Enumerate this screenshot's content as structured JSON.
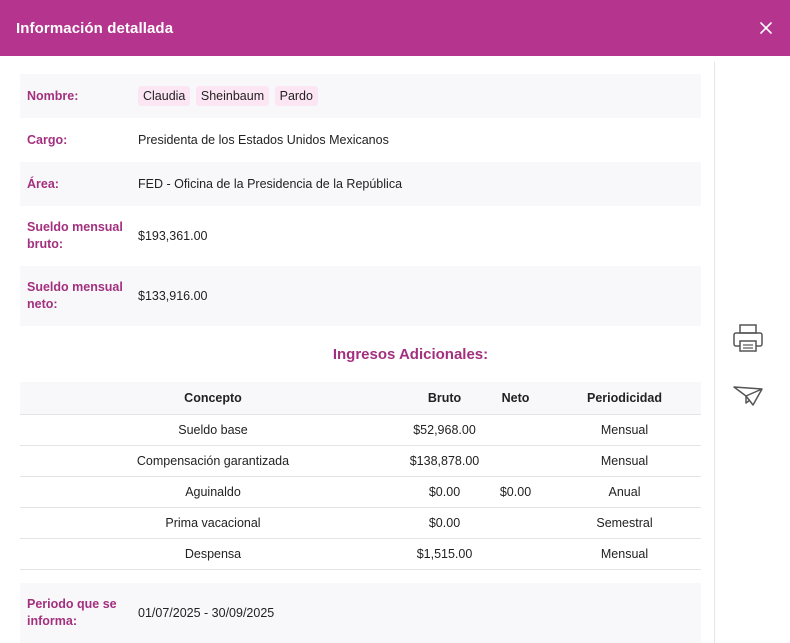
{
  "colors": {
    "brand": "#b5358e",
    "label": "#a3307f",
    "icon": "#555555"
  },
  "header": {
    "title": "Información detallada",
    "close_icon": "close-icon"
  },
  "info": {
    "nombre": {
      "label": "Nombre:",
      "parts": [
        "Claudia",
        "Sheinbaum",
        "Pardo"
      ]
    },
    "cargo": {
      "label": "Cargo:",
      "value": "Presidenta de los Estados Unidos Mexicanos"
    },
    "area": {
      "label": "Área:",
      "value": "FED - Oficina de la Presidencia de la República"
    },
    "bruto": {
      "label": "Sueldo mensual bruto:",
      "value": "$193,361.00"
    },
    "neto": {
      "label": "Sueldo mensual neto:",
      "value": "$133,916.00"
    }
  },
  "ingresos": {
    "title": "Ingresos Adicionales:",
    "headers": [
      "Concepto",
      "Bruto",
      "Neto",
      "Periodicidad"
    ],
    "rows": [
      {
        "concepto": "Sueldo base",
        "bruto": "$52,968.00",
        "neto": "",
        "periodicidad": "Mensual"
      },
      {
        "concepto": "Compensación garantizada",
        "bruto": "$138,878.00",
        "neto": "",
        "periodicidad": "Mensual"
      },
      {
        "concepto": "Aguinaldo",
        "bruto": "$0.00",
        "neto": "$0.00",
        "periodicidad": "Anual"
      },
      {
        "concepto": "Prima vacacional",
        "bruto": "$0.00",
        "neto": "",
        "periodicidad": "Semestral"
      },
      {
        "concepto": "Despensa",
        "bruto": "$1,515.00",
        "neto": "",
        "periodicidad": "Mensual"
      }
    ]
  },
  "periodo": {
    "label": "Periodo que se informa:",
    "value": "01/07/2025 - 30/09/2025"
  },
  "actions": {
    "print_icon": "printer-icon",
    "send_icon": "paper-plane-icon"
  }
}
